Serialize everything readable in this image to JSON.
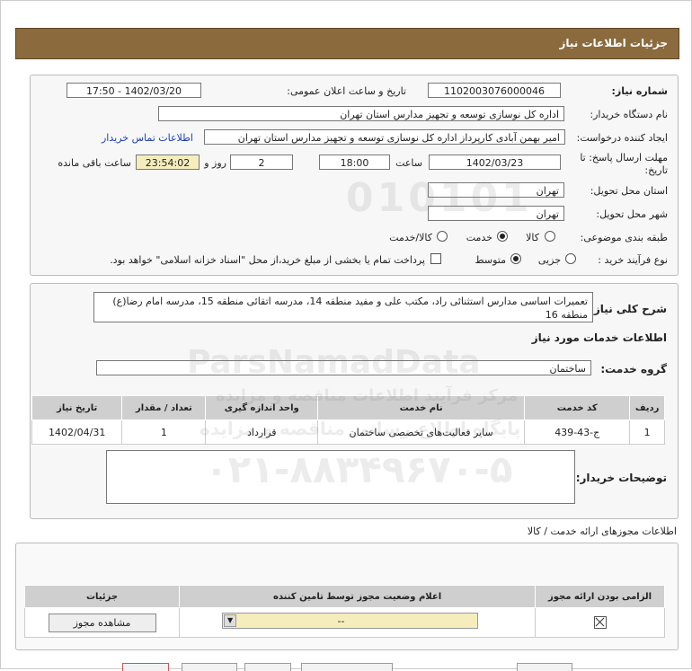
{
  "header": {
    "title": "جزئیات اطلاعات نیاز"
  },
  "form": {
    "need_number_label": "شماره نیاز:",
    "need_number": "1102003076000046",
    "announce_label": "تاریخ و ساعت اعلان عمومی:",
    "announce_value": "1402/03/20 - 17:50",
    "buyer_label": "نام دستگاه خریدار:",
    "buyer_value": "اداره کل نوسازی  توسعه و تجهیز مدارس استان تهران",
    "requester_label": "ایجاد کننده درخواست:",
    "requester_value": "امیر بهمن آبادی کارپرداز اداره کل نوسازی  توسعه و تجهیز مدارس استان تهران",
    "contact_link": "اطلاعات تماس خریدار",
    "deadline_label_1": "مهلت ارسال پاسخ: تا",
    "deadline_label_2": "تاریخ:",
    "deadline_date": "1402/03/23",
    "time_label": "ساعت",
    "deadline_time": "18:00",
    "days_value": "2",
    "days_label": "روز و",
    "remaining_value": "23:54:02",
    "remaining_label": "ساعت باقی مانده",
    "province_label": "استان محل تحویل:",
    "province_value": "تهران",
    "city_label": "شهر محل تحویل:",
    "city_value": "تهران",
    "category_label": "طبقه بندی موضوعی:",
    "category_options": [
      "کالا",
      "خدمت",
      "کالا/خدمت"
    ],
    "process_label": "نوع فرآیند خرید :",
    "process_options": [
      "جزیی",
      "متوسط"
    ],
    "payment_note": "پرداخت تمام یا بخشی از مبلغ خرید،از محل \"اسناد خزانه اسلامی\" خواهد بود."
  },
  "description": {
    "label": "شرح کلی نیاز:",
    "text": "تعمیرات اساسی مدارس استثنائی راد، مکتب علی و مفید منطقه 14، مدرسه اتقائی منطقه 15، مدرسه امام رضا(ع) منطقه 16"
  },
  "services": {
    "section_title": "اطلاعات خدمات مورد نیاز",
    "group_label": "گروه خدمت:",
    "group_value": "ساختمان",
    "columns": [
      "ردیف",
      "کد خدمت",
      "نام خدمت",
      "واحد اندازه گیری",
      "تعداد / مقدار",
      "تاریخ نیاز"
    ],
    "rows": [
      [
        "1",
        "ج-43-439",
        "سایر فعالیت‌های تخصصی ساختمان",
        "قرارداد",
        "1",
        "1402/04/31"
      ]
    ]
  },
  "buyer_notes": {
    "label": "توضیحات خریدار:",
    "value": ""
  },
  "permits": {
    "section_title": "اطلاعات مجوزهای ارائه خدمت / کالا",
    "columns": [
      "الزامی بودن ارائه مجوز",
      "اعلام وضعیت مجوز توسط تامین کننده",
      "جزئیات"
    ],
    "select_value": "--",
    "view_button": "مشاهده مجوز"
  },
  "watermark": {
    "line1": "ParsNamadData",
    "line2": "مرکز فرآیند اطلاعات مناقصه و مزایده",
    "line3": "پایگاه اطلاع رسانی مناقصه و مزایده",
    "phone": "۰۲۱-۸۸۳۴۹۶۷۰-۵",
    "digits": "010101"
  },
  "colors": {
    "header": "#8b6b3e",
    "link": "#1c3fb5",
    "highlight": "#f6edbd"
  }
}
